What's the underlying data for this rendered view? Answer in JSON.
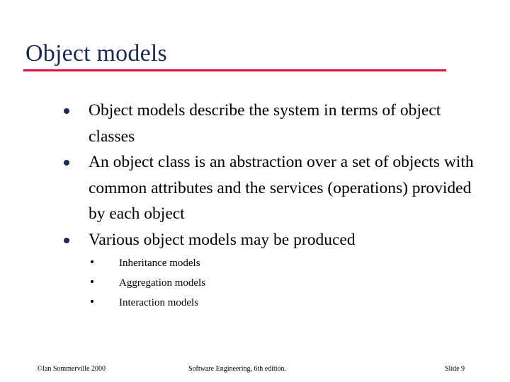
{
  "slide": {
    "title": "Object models",
    "accent_rule_color": "#d6123c",
    "title_color": "#1b2a55",
    "body_color": "#000000",
    "background_color": "#ffffff",
    "bullets": [
      {
        "text": "Object models describe the system in terms of object classes"
      },
      {
        "text": "An object class is an abstraction over a set of objects with common attributes and the services (operations) provided by each object"
      },
      {
        "text": "Various object models may be produced"
      }
    ],
    "sub_bullets": [
      {
        "text": "Inheritance models"
      },
      {
        "text": "Aggregation models"
      },
      {
        "text": "Interaction models"
      }
    ],
    "footer": {
      "left": "©Ian Sommerville 2000",
      "center": "Software Engineering, 6th edition.",
      "right": "Slide 9"
    }
  }
}
